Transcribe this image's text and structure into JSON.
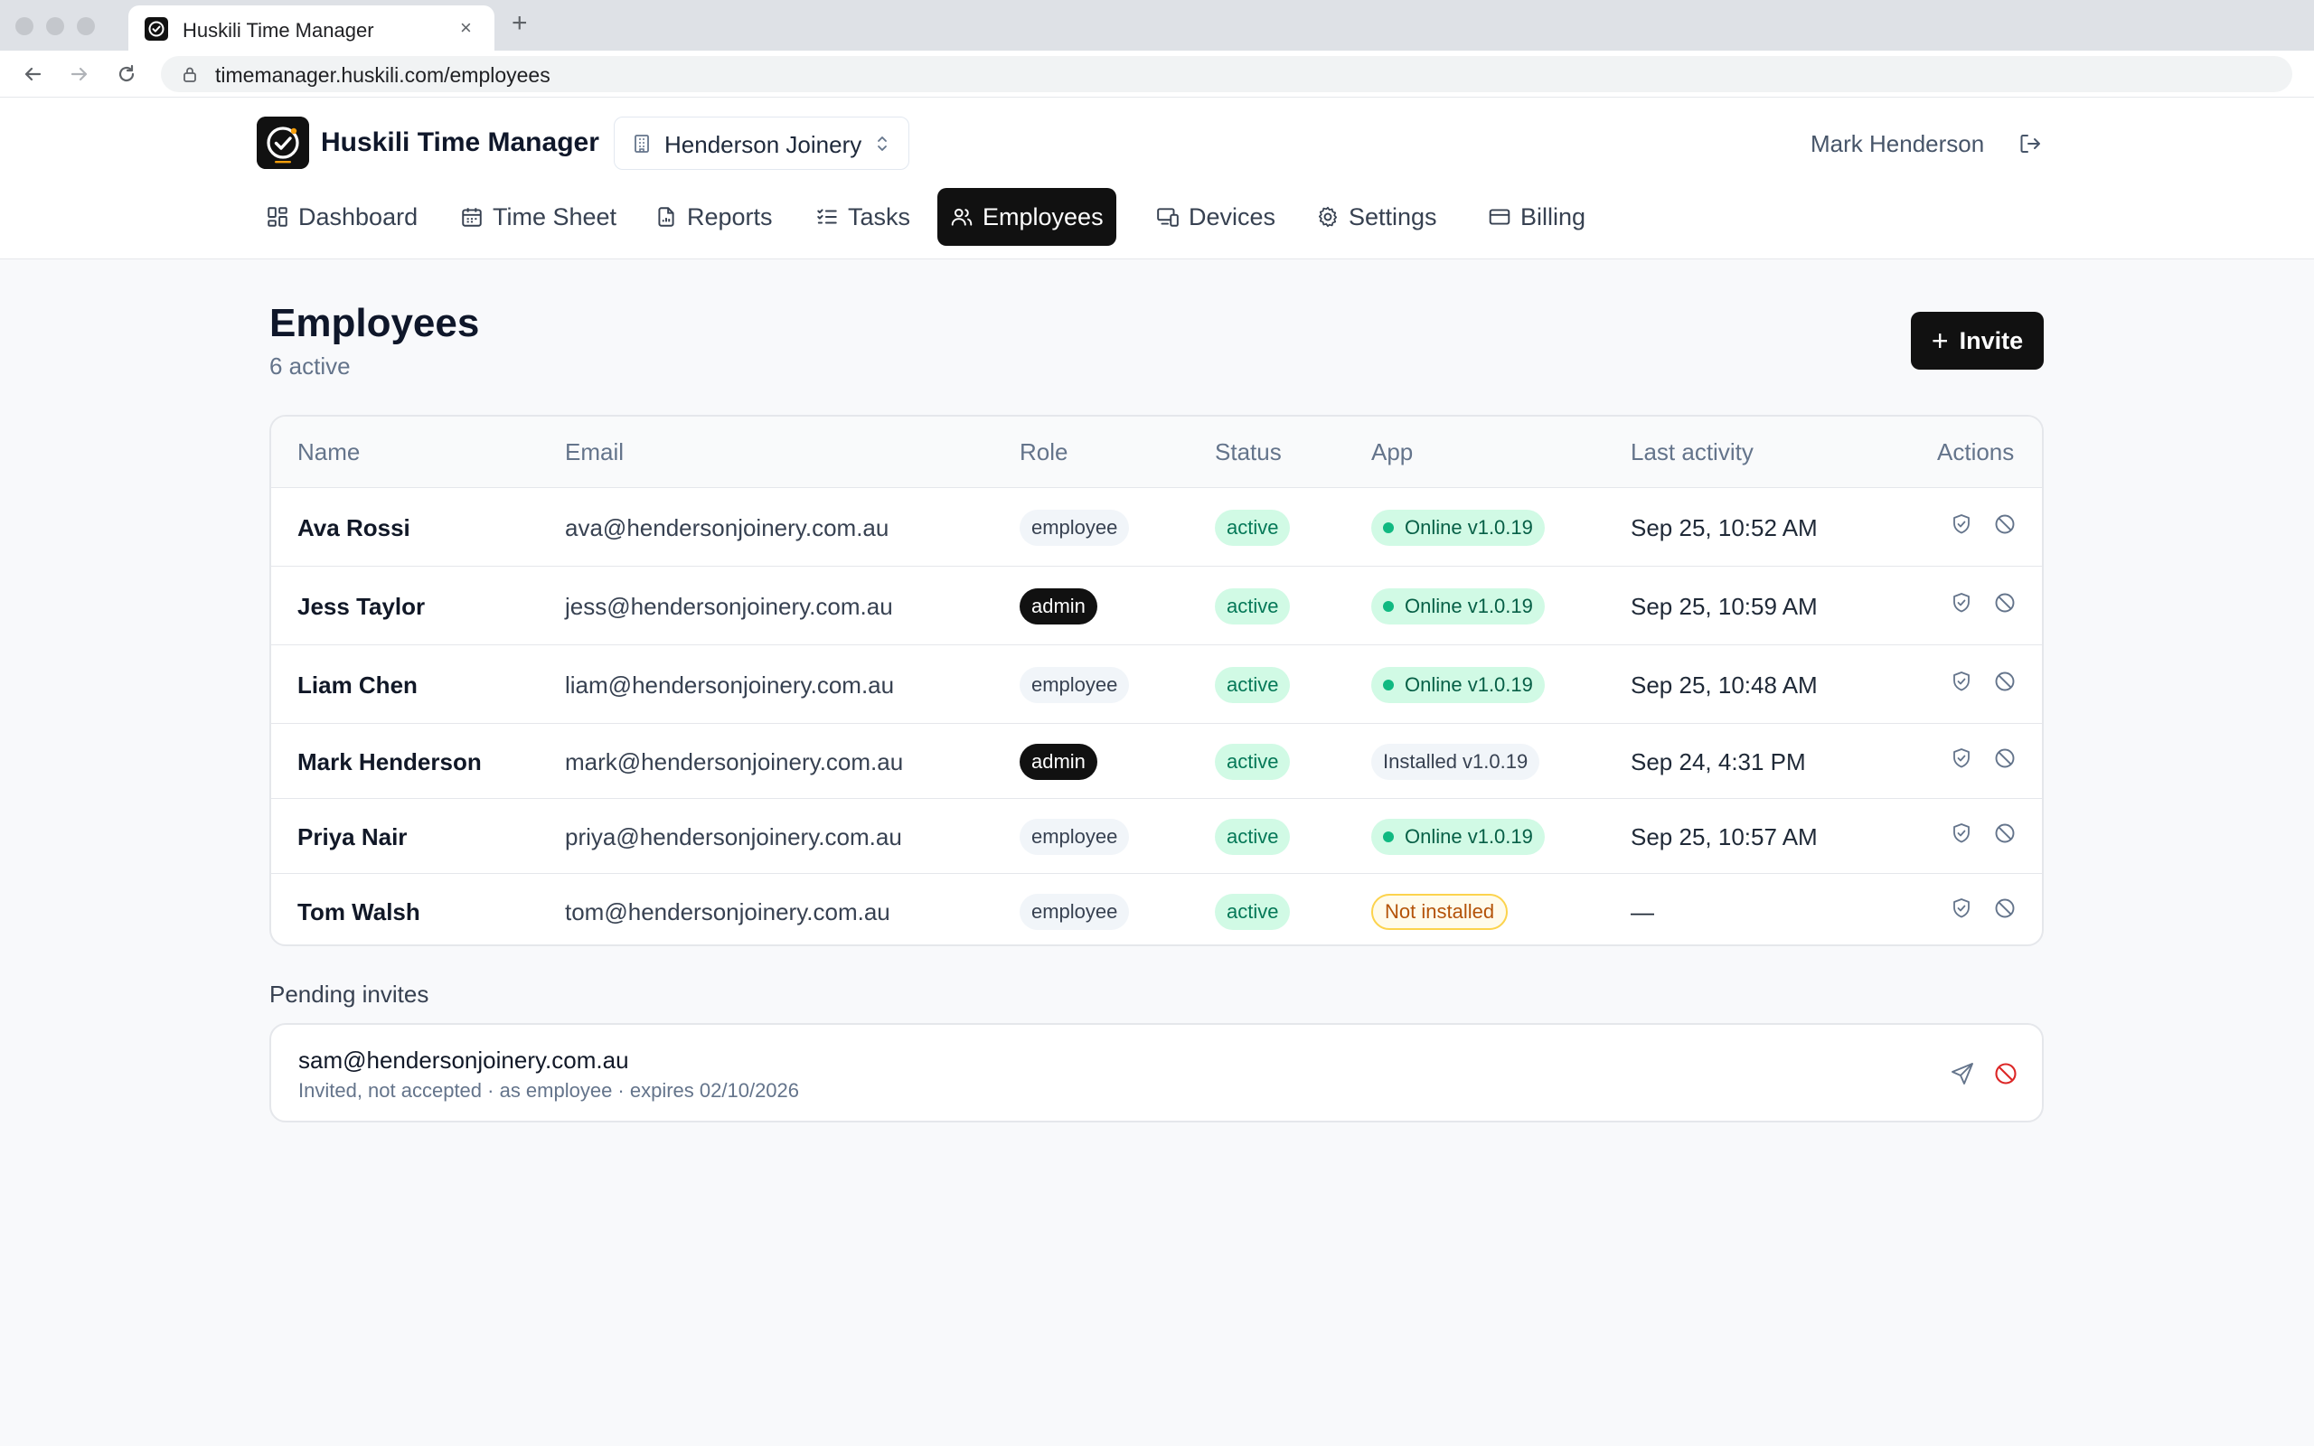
{
  "browser": {
    "tab_title": "Huskili Time Manager",
    "tab_close": "×",
    "new_tab": "+",
    "url": "timemanager.huskili.com/employees"
  },
  "header": {
    "app_title": "Huskili Time Manager",
    "org_name": "Henderson Joinery",
    "user_name": "Mark Henderson"
  },
  "nav": [
    {
      "label": "Dashboard",
      "icon": "dashboard-icon",
      "active": false
    },
    {
      "label": "Time Sheet",
      "icon": "calendar-icon",
      "active": false
    },
    {
      "label": "Reports",
      "icon": "file-icon",
      "active": false
    },
    {
      "label": "Tasks",
      "icon": "list-checks-icon",
      "active": false
    },
    {
      "label": "Employees",
      "icon": "users-icon",
      "active": true
    },
    {
      "label": "Devices",
      "icon": "devices-icon",
      "active": false
    },
    {
      "label": "Settings",
      "icon": "gear-icon",
      "active": false
    },
    {
      "label": "Billing",
      "icon": "credit-card-icon",
      "active": false
    }
  ],
  "page": {
    "title": "Employees",
    "subtitle": "6 active",
    "invite_label": "Invite"
  },
  "table": {
    "columns": [
      "Name",
      "Email",
      "Role",
      "Status",
      "App",
      "Last activity",
      "Actions"
    ],
    "rows": [
      {
        "name": "Ava Rossi",
        "email": "ava@hendersonjoinery.com.au",
        "role": "employee",
        "status": "active",
        "app": "Online v1.0.19",
        "app_state": "online",
        "last_activity": "Sep 25, 10:52 AM"
      },
      {
        "name": "Jess Taylor",
        "email": "jess@hendersonjoinery.com.au",
        "role": "admin",
        "status": "active",
        "app": "Online v1.0.19",
        "app_state": "online",
        "last_activity": "Sep 25, 10:59 AM"
      },
      {
        "name": "Liam Chen",
        "email": "liam@hendersonjoinery.com.au",
        "role": "employee",
        "status": "active",
        "app": "Online v1.0.19",
        "app_state": "online",
        "last_activity": "Sep 25, 10:48 AM"
      },
      {
        "name": "Mark Henderson",
        "email": "mark@hendersonjoinery.com.au",
        "role": "admin",
        "status": "active",
        "app": "Installed v1.0.19",
        "app_state": "installed",
        "last_activity": "Sep 24, 4:31 PM"
      },
      {
        "name": "Priya Nair",
        "email": "priya@hendersonjoinery.com.au",
        "role": "employee",
        "status": "active",
        "app": "Online v1.0.19",
        "app_state": "online",
        "last_activity": "Sep 25, 10:57 AM"
      },
      {
        "name": "Tom Walsh",
        "email": "tom@hendersonjoinery.com.au",
        "role": "employee",
        "status": "active",
        "app": "Not installed",
        "app_state": "not-installed",
        "last_activity": "—"
      }
    ]
  },
  "pending": {
    "label": "Pending invites",
    "invites": [
      {
        "email": "sam@hendersonjoinery.com.au",
        "meta": "Invited, not accepted · as employee · expires 02/10/2026"
      }
    ]
  },
  "colors": {
    "accent_dark": "#111111",
    "status_green": "#047857",
    "warning_amber": "#b45309",
    "danger_red": "#dc2626"
  }
}
